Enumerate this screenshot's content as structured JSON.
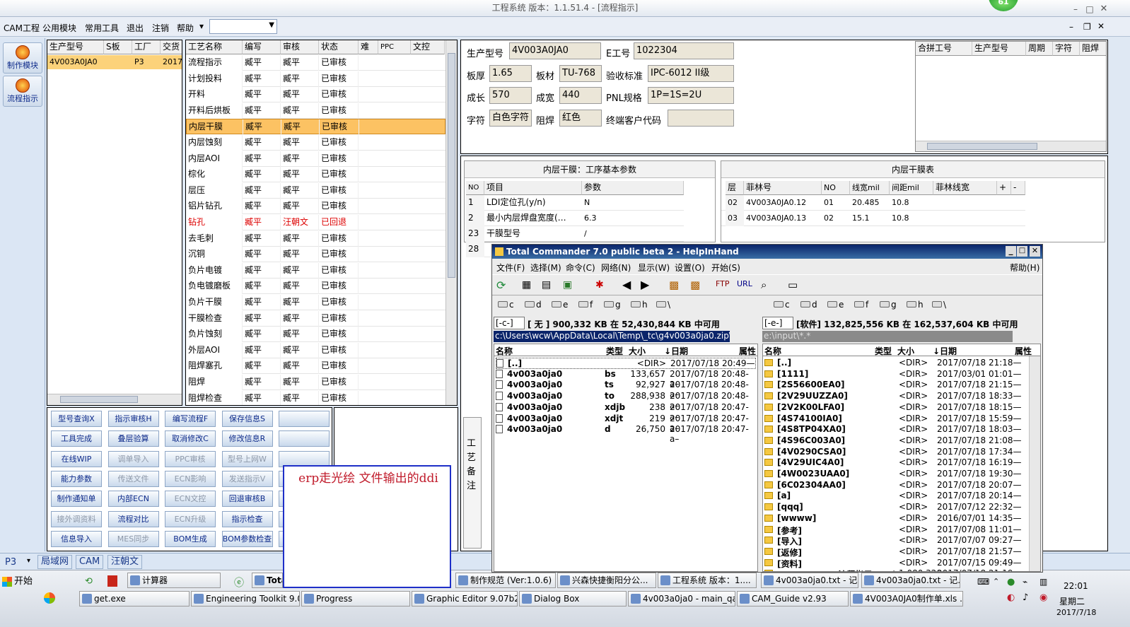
{
  "window": {
    "title": "工程系统  版本：1.1.51.4 - [流程指示]",
    "badge": "61"
  },
  "menu": {
    "items": [
      "CAM工程",
      "公用模块",
      "常用工具",
      "退出",
      "注销",
      "帮助"
    ]
  },
  "side": {
    "btn1": "制作模块",
    "btn2": "流程指示"
  },
  "model_grid": {
    "headers": [
      "生产型号",
      "S板",
      "工厂",
      "交货"
    ],
    "row": [
      "4V003A0JA0",
      "",
      "P3",
      "2017"
    ]
  },
  "process_grid": {
    "headers": [
      "工艺名称",
      "编写",
      "审核",
      "状态",
      "难",
      "PPC",
      "文控"
    ],
    "rows": [
      [
        "流程指示",
        "臧平",
        "臧平",
        "已审核"
      ],
      [
        "计划投料",
        "臧平",
        "臧平",
        "已审核"
      ],
      [
        "开料",
        "臧平",
        "臧平",
        "已审核"
      ],
      [
        "开料后烘板",
        "臧平",
        "臧平",
        "已审核"
      ],
      [
        "内层干膜",
        "臧平",
        "臧平",
        "已审核"
      ],
      [
        "内层蚀刻",
        "臧平",
        "臧平",
        "已审核"
      ],
      [
        "内层AOI",
        "臧平",
        "臧平",
        "已审核"
      ],
      [
        "棕化",
        "臧平",
        "臧平",
        "已审核"
      ],
      [
        "层压",
        "臧平",
        "臧平",
        "已审核"
      ],
      [
        "铝片钻孔",
        "臧平",
        "臧平",
        "已审核"
      ],
      [
        "钻孔",
        "臧平",
        "汪朝文",
        "已回退"
      ],
      [
        "去毛刺",
        "臧平",
        "臧平",
        "已审核"
      ],
      [
        "沉铜",
        "臧平",
        "臧平",
        "已审核"
      ],
      [
        "负片电镀",
        "臧平",
        "臧平",
        "已审核"
      ],
      [
        "负电镀磨板",
        "臧平",
        "臧平",
        "已审核"
      ],
      [
        "负片干膜",
        "臧平",
        "臧平",
        "已审核"
      ],
      [
        "干膜检查",
        "臧平",
        "臧平",
        "已审核"
      ],
      [
        "负片蚀刻",
        "臧平",
        "臧平",
        "已审核"
      ],
      [
        "外层AOI",
        "臧平",
        "臧平",
        "已审核"
      ],
      [
        "阻焊塞孔",
        "臧平",
        "臧平",
        "已审核"
      ],
      [
        "阻焊",
        "臧平",
        "臧平",
        "已审核"
      ],
      [
        "阻焊检查",
        "臧平",
        "臧平",
        "已审核"
      ]
    ]
  },
  "info": {
    "lbl_model": "生产型号",
    "model": "4V003A0JA0",
    "lbl_e": "E工号",
    "e_no": "1022304",
    "lbl_thick": "板厚",
    "thick": "1.65",
    "lbl_mat": "板材",
    "mat": "TU-768",
    "lbl_std": "验收标准",
    "std": "IPC-6012 II级",
    "lbl_len": "成长",
    "len": "570",
    "lbl_wid": "成宽",
    "wid": "440",
    "lbl_pnl": "PNL规格",
    "pnl": "1P=1S=2U",
    "lbl_char": "字符",
    "char": "白色字符",
    "lbl_mask": "阻焊",
    "mask": "红色",
    "lbl_cust": "终端客户代码",
    "cust": ""
  },
  "merge_grid": {
    "headers": [
      "合拼工号",
      "生产型号",
      "周期",
      "字符",
      "阻焊"
    ]
  },
  "param_panel": {
    "title": "内层干膜：工序基本参数",
    "headers": [
      "NO",
      "项目",
      "参数"
    ],
    "rows": [
      [
        "1",
        "LDI定位孔(y/n)",
        "N"
      ],
      [
        "2",
        "最小内层焊盘宽度(…",
        "6.3"
      ],
      [
        "23",
        "干膜型号",
        "/"
      ],
      [
        "28",
        "",
        ""
      ]
    ]
  },
  "film_panel": {
    "title": "内层干膜表",
    "headers": [
      "层",
      "菲林号",
      "NO",
      "线宽mil",
      "间距mil",
      "菲林线宽",
      "+",
      "-"
    ],
    "rows": [
      [
        "02",
        "4V003A0JA0.12",
        "01",
        "20.485",
        "10.8"
      ],
      [
        "03",
        "4V003A0JA0.13",
        "02",
        "15.1",
        "10.8"
      ]
    ]
  },
  "buttons": [
    [
      "型号查询X",
      "指示审核H",
      "编写流程F",
      "保存信息S",
      ""
    ],
    [
      "工具完成",
      "叠层验算",
      "取消修改C",
      "修改信息R",
      ""
    ],
    [
      "在线WIP",
      "调单导入",
      "PPC审核",
      "型号上网W",
      ""
    ],
    [
      "能力参数",
      "传送文件",
      "ECN影响",
      "发送指示V",
      ""
    ],
    [
      "制作通知单",
      "内部ECN",
      "ECN文控",
      "回退审核B",
      ""
    ],
    [
      "接外调资料",
      "流程对比",
      "ECN升级",
      "指示检查",
      ""
    ],
    [
      "信息导入",
      "MES同步",
      "BOM生成",
      "BOM参数检查",
      ""
    ]
  ],
  "note_label": "工艺备注",
  "annotation": "erp走光绘   文件输出的ddi",
  "tc": {
    "title": "Total Commander 7.0 public beta 2 - HelpInHand",
    "menu": [
      "文件(F)",
      "选择(M)",
      "命令(C)",
      "网络(N)",
      "显示(W)",
      "设置(O)",
      "开始(S)"
    ],
    "help": "帮助(H)",
    "drives": [
      "c",
      "d",
      "e",
      "f",
      "g",
      "h",
      "\\"
    ],
    "left_drive": "[-c-]",
    "left_info": "[ 无 ]  900,332 KB 在 52,430,844 KB 中可用",
    "left_path": "c:\\Users\\wcw\\AppData\\Local\\Temp\\_tc\\g4v003a0ja0.zip\\",
    "right_drive": "[-e-]",
    "right_info": "[软件]  132,825,556 KB 在 162,537,604 KB 中可用",
    "right_path": "e:\\input\\*.*",
    "cols": [
      "名称",
      "类型",
      "大小",
      "↓日期",
      "属性"
    ],
    "left_files": [
      [
        "[..]",
        "",
        "<DIR>",
        "2017/07/18 20:49—"
      ],
      [
        "4v003a0ja0",
        "bs",
        "133,657",
        "2017/07/18 20:48-a–"
      ],
      [
        "4v003a0ja0",
        "ts",
        "92,927",
        "2017/07/18 20:48-a–"
      ],
      [
        "4v003a0ja0",
        "to",
        "288,938",
        "2017/07/18 20:48-a–"
      ],
      [
        "4v003a0ja0",
        "xdjb",
        "238",
        "2017/07/18 20:47-a–"
      ],
      [
        "4v003a0ja0",
        "xdjt",
        "219",
        "2017/07/18 20:47-a–"
      ],
      [
        "4v003a0ja0",
        "d",
        "26,750",
        "2017/07/18 20:47-a–"
      ]
    ],
    "right_files": [
      [
        "[..]",
        "<DIR>",
        "2017/07/18 21:18—"
      ],
      [
        "[1111]",
        "<DIR>",
        "2017/03/01 01:01—"
      ],
      [
        "[2S56600EA0]",
        "<DIR>",
        "2017/07/18 21:15—"
      ],
      [
        "[2V29UUZZA0]",
        "<DIR>",
        "2017/07/18 18:33—"
      ],
      [
        "[2V2K00LFA0]",
        "<DIR>",
        "2017/07/18 18:15—"
      ],
      [
        "[4S74100IA0]",
        "<DIR>",
        "2017/07/18 15:59—"
      ],
      [
        "[4S8TP04XA0]",
        "<DIR>",
        "2017/07/18 18:03—"
      ],
      [
        "[4S96C003A0]",
        "<DIR>",
        "2017/07/18 21:08—"
      ],
      [
        "[4V0290CSA0]",
        "<DIR>",
        "2017/07/18 17:34—"
      ],
      [
        "[4V29UIC4A0]",
        "<DIR>",
        "2017/07/18 16:19—"
      ],
      [
        "[4W0023UAA0]",
        "<DIR>",
        "2017/07/18 19:30—"
      ],
      [
        "[6C02304AA0]",
        "<DIR>",
        "2017/07/18 20:07—"
      ],
      [
        "[a]",
        "<DIR>",
        "2017/07/18 20:14—"
      ],
      [
        "[qqq]",
        "<DIR>",
        "2017/07/12 22:32—"
      ],
      [
        "[wwww]",
        "<DIR>",
        "2016/07/01 14:35—"
      ],
      [
        "[参考]",
        "<DIR>",
        "2017/07/08 11:01—"
      ],
      [
        "[导入]",
        "<DIR>",
        "2017/07/07 09:27—"
      ],
      [
        "[返修]",
        "<DIR>",
        "2017/07/18 21:57—"
      ],
      [
        "[资料]",
        "<DIR>",
        "2017/07/15 09:49—"
      ],
      [
        "4V003A0JA0 流程指示… .xls",
        "1,080,320",
        "2017/07/18 21:19-a"
      ]
    ]
  },
  "status": {
    "factory": "P3",
    "tab1": "局域网",
    "tab2": "CAM",
    "tab3": "汪朝文"
  },
  "taskbar": {
    "start": "开始",
    "row1": [
      "计算器",
      "Tota",
      "制作规范 (Ver:1.0.6)",
      "兴森快捷衡阳分公...",
      "工程系统  版本：1....",
      "4v003a0ja0.txt - 记...",
      "4v003a0ja0.txt - 记..."
    ],
    "row2": [
      "get.exe",
      "Engineering Toolkit 9.07...",
      "Progress",
      "Graphic Editor 9.07b2 (0...",
      "Dialog Box",
      "4v003a0ja0 - main_qa",
      "CAM_Guide v2.93",
      "4V003A0JA0制作单.xls ..."
    ],
    "time": "22:01",
    "day": "星期二",
    "date": "2017/7/18"
  }
}
